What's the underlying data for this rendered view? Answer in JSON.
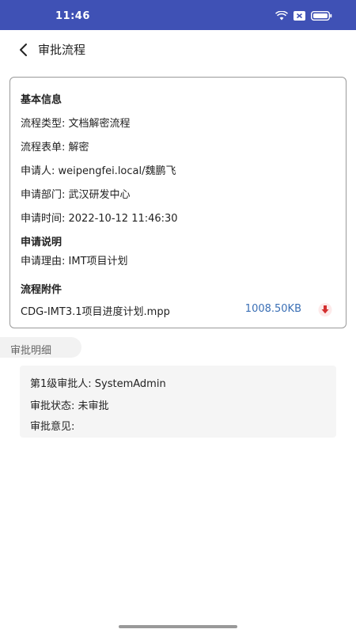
{
  "status_bar": {
    "time": "11:46",
    "icons": [
      "wifi-icon",
      "sim-icon",
      "battery-icon"
    ],
    "background": "#3f51b5"
  },
  "header": {
    "back_icon": "chevron-left-icon",
    "title": "审批流程"
  },
  "basic_info": {
    "section_title": "基本信息",
    "flow_type": "流程类型: 文档解密流程",
    "flow_form": "流程表单: 解密",
    "applicant": "申请人: weipengfei.local/魏鹏飞",
    "department": "申请部门: 武汉研发中心",
    "apply_time": "申请时间: 2022-10-12 11:46:30"
  },
  "apply_note": {
    "section_title": "申请说明",
    "reason": "申请理由: IMT项目计划"
  },
  "attachments": {
    "section_title": "流程附件",
    "files": [
      {
        "name": "CDG-IMT3.1项目进度计划.mpp",
        "size": "1008.50KB",
        "icon": "download-icon"
      }
    ]
  },
  "approval_detail": {
    "tab_label": "审批明细",
    "approvers": [
      {
        "level": "第1级审批人: SystemAdmin",
        "status": "审批状态: 未审批",
        "opinion": "审批意见:"
      }
    ]
  },
  "colors": {
    "accent": "#3f51b5",
    "file_size": "#3a6fb5",
    "download": "#d32f2f"
  }
}
